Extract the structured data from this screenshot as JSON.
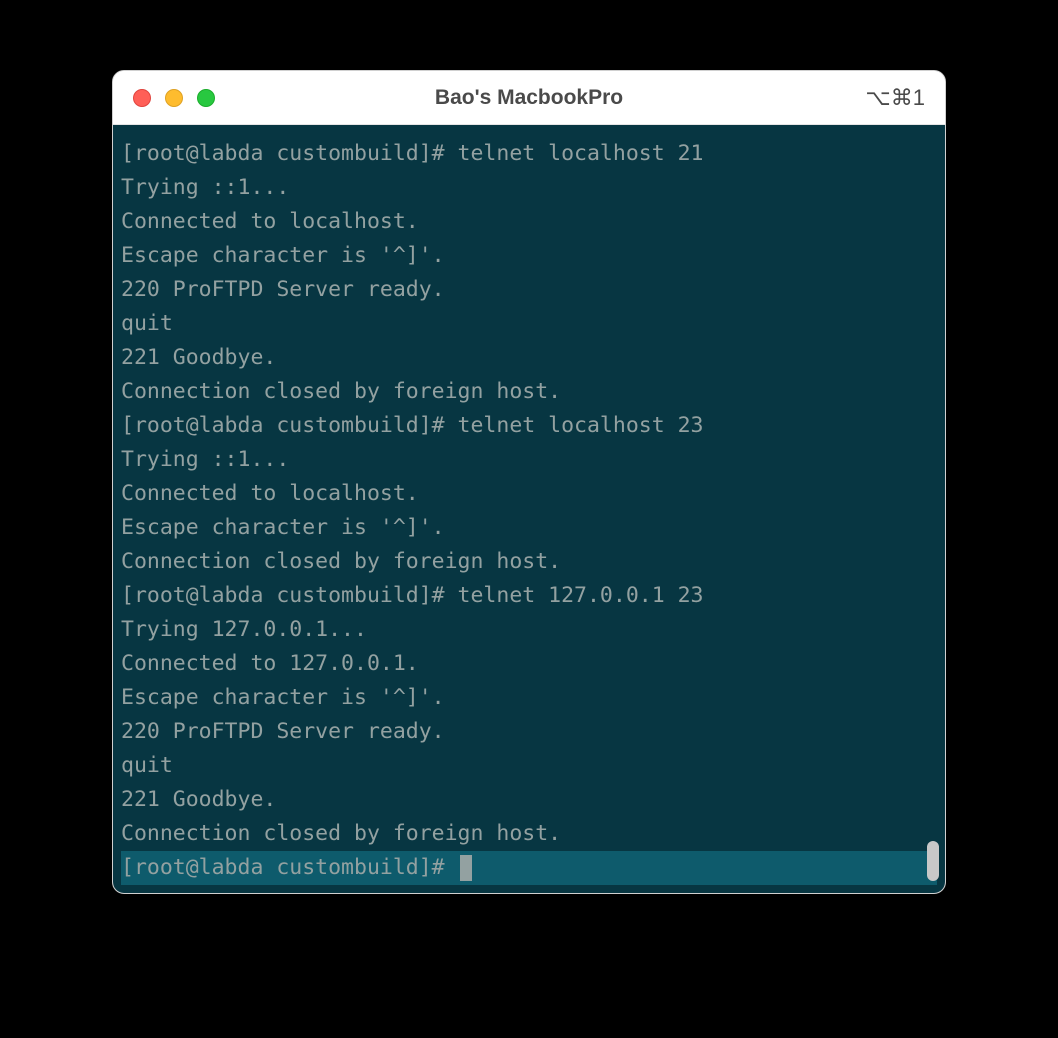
{
  "window": {
    "title": "Bao's MacbookPro",
    "shortcut": "⌥⌘1"
  },
  "terminal": {
    "lines": [
      "[root@labda custombuild]# telnet localhost 21",
      "Trying ::1...",
      "Connected to localhost.",
      "Escape character is '^]'.",
      "220 ProFTPD Server ready.",
      "quit",
      "221 Goodbye.",
      "Connection closed by foreign host.",
      "[root@labda custombuild]# telnet localhost 23",
      "Trying ::1...",
      "Connected to localhost.",
      "Escape character is '^]'.",
      "Connection closed by foreign host.",
      "[root@labda custombuild]# telnet 127.0.0.1 23",
      "Trying 127.0.0.1...",
      "Connected to 127.0.0.1.",
      "Escape character is '^]'.",
      "220 ProFTPD Server ready.",
      "quit",
      "221 Goodbye.",
      "Connection closed by foreign host."
    ],
    "prompt": "[root@labda custombuild]# "
  }
}
